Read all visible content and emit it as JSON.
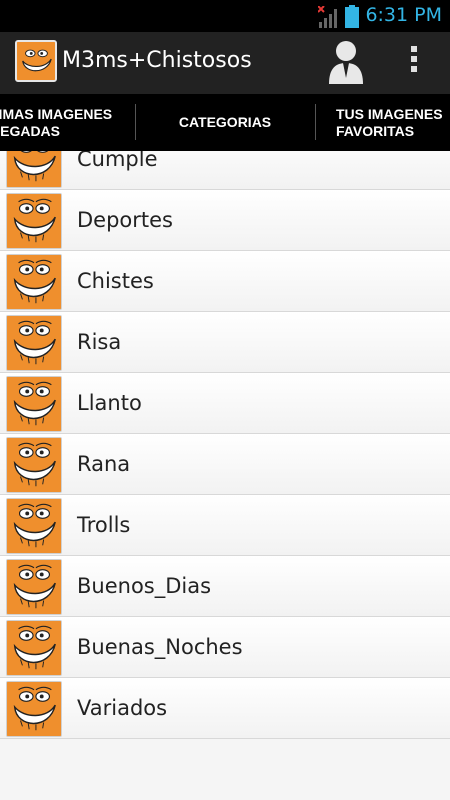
{
  "status_bar": {
    "time": "6:31 PM",
    "signal_icon": "signal-bars-icon",
    "battery_icon": "battery-icon",
    "accent_color": "#33b5e5"
  },
  "action_bar": {
    "title": "M3ms+Chistosos",
    "logo_icon": "troll-face-icon",
    "user_icon": "user-icon",
    "menu_icon": "overflow-menu-icon"
  },
  "tabs": [
    {
      "label_line1": "TIMAS IMAGENES",
      "label_line2": "REGADAS"
    },
    {
      "label_line1": "CATEGORIAS",
      "label_line2": ""
    },
    {
      "label_line1": "TUS IMAGENES",
      "label_line2": "FAVORITAS"
    }
  ],
  "selected_tab": "CATEGORIAS",
  "categories": [
    {
      "label": "Cumple"
    },
    {
      "label": "Deportes"
    },
    {
      "label": "Chistes"
    },
    {
      "label": "Risa"
    },
    {
      "label": "Llanto"
    },
    {
      "label": "Rana"
    },
    {
      "label": "Trolls"
    },
    {
      "label": "Buenos_Dias"
    },
    {
      "label": "Buenas_Noches"
    },
    {
      "label": "Variados"
    }
  ]
}
